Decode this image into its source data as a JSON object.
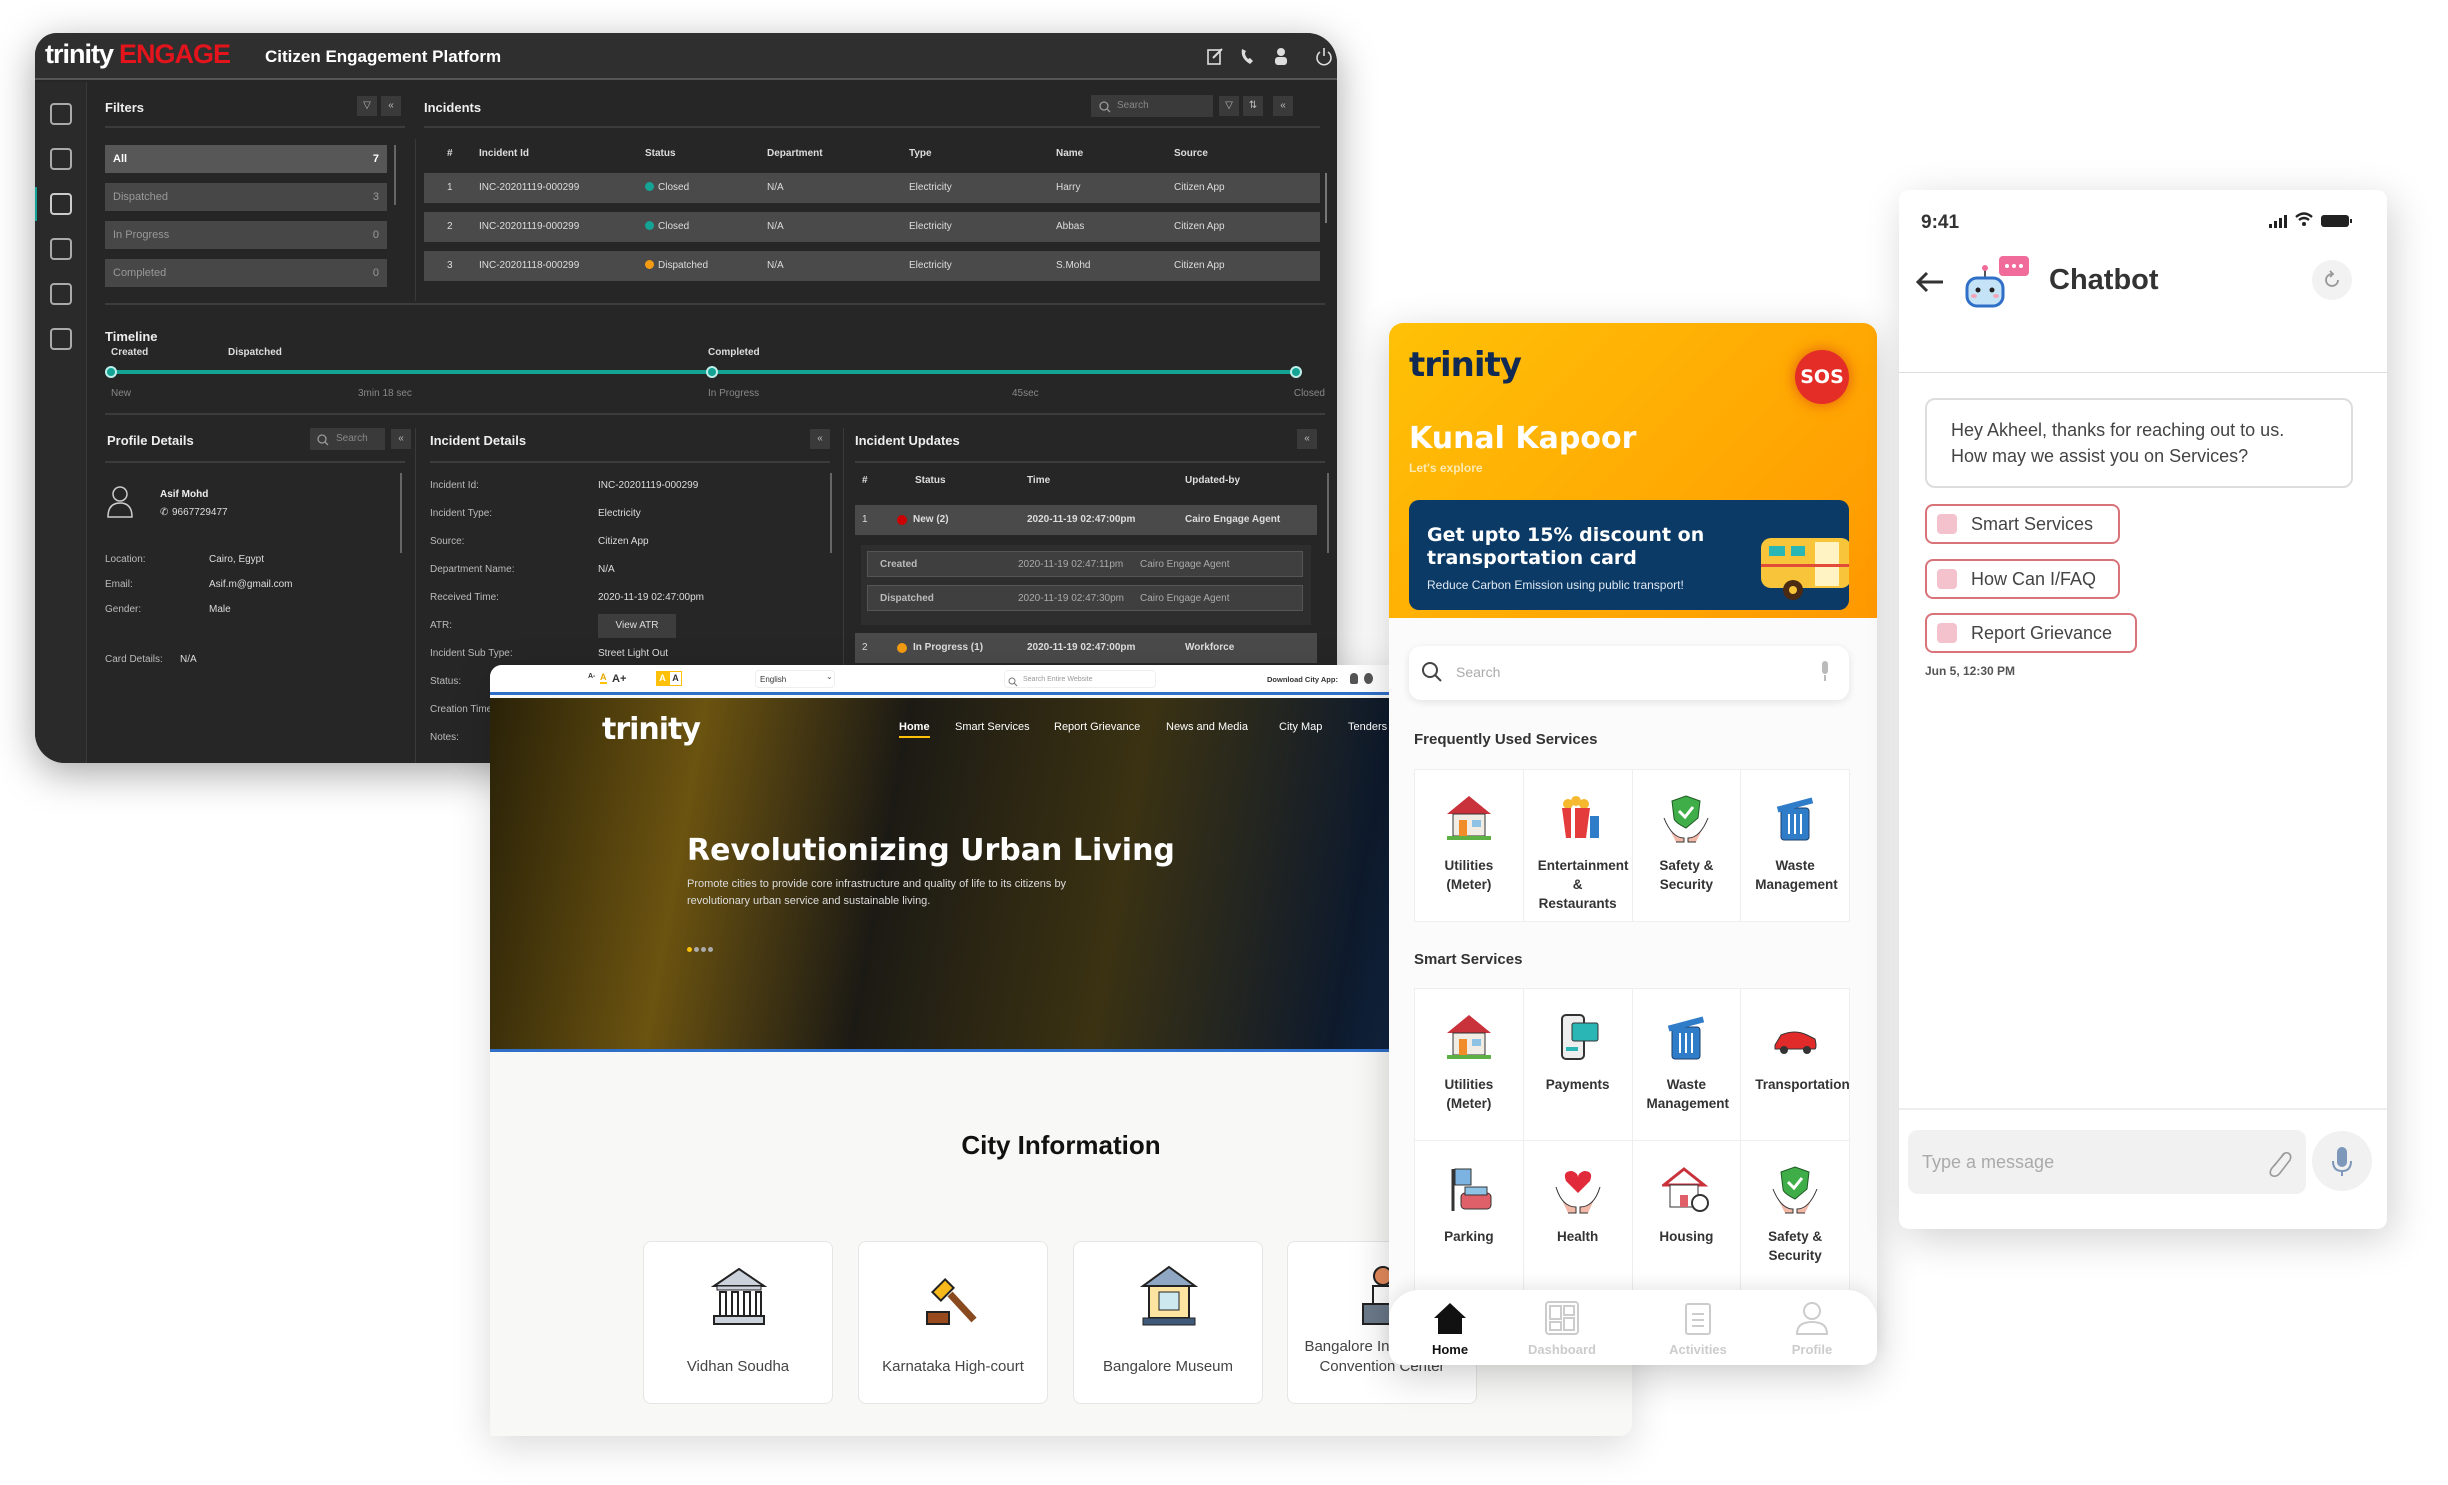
{
  "dashboard": {
    "brand_a": "trinity",
    "brand_b": "ENGAGE",
    "title": "Citizen Engagement Platform",
    "header_icons": [
      "edit-icon",
      "phone-icon",
      "user-icon",
      "power-icon"
    ],
    "sidebar_icons": [
      "dashboard-icon",
      "home-icon",
      "alarm-icon",
      "phone-icon",
      "clipboard-icon",
      "gear-icon"
    ],
    "filters": {
      "title": "Filters",
      "items": [
        {
          "label": "All",
          "count": "7"
        },
        {
          "label": "Dispatched",
          "count": "3"
        },
        {
          "label": "In Progress",
          "count": "0"
        },
        {
          "label": "Completed",
          "count": "0"
        }
      ]
    },
    "incidents": {
      "title": "Incidents",
      "search_placeholder": "Search",
      "columns": [
        "#",
        "Incident Id",
        "Status",
        "Department",
        "Type",
        "Name",
        "Source"
      ],
      "rows": [
        {
          "num": "1",
          "id": "INC-20201119-000299",
          "status": "Closed",
          "status_color": "#14a394",
          "dept": "N/A",
          "type": "Electricity",
          "name": "Harry",
          "source": "Citizen App"
        },
        {
          "num": "2",
          "id": "INC-20201119-000299",
          "status": "Closed",
          "status_color": "#14a394",
          "dept": "N/A",
          "type": "Electricity",
          "name": "Abbas",
          "source": "Citizen App"
        },
        {
          "num": "3",
          "id": "INC-20201118-000299",
          "status": "Dispatched",
          "status_color": "#f39c12",
          "dept": "N/A",
          "type": "Electricity",
          "name": "S.Mohd",
          "source": "Citizen App"
        }
      ]
    },
    "timeline": {
      "title": "Timeline",
      "top_labels": [
        "Created",
        "Dispatched",
        "Completed"
      ],
      "bottom_labels": [
        "New",
        "3min 18 sec",
        "In Progress",
        "45sec",
        "Closed"
      ],
      "color": "#14a394"
    },
    "profile": {
      "title": "Profile Details",
      "search_placeholder": "Search",
      "name": "Asif Mohd",
      "phone": "9667729477",
      "fields": [
        {
          "label": "Location:",
          "value": "Cairo, Egypt"
        },
        {
          "label": "Email:",
          "value": "Asif.m@gmail.com"
        },
        {
          "label": "Gender:",
          "value": "Male"
        },
        {
          "label": "Card Details:",
          "value": "N/A"
        }
      ]
    },
    "incident_details": {
      "title": "Incident Details",
      "atr_button": "View ATR",
      "fields": [
        {
          "label": "Incident Id:",
          "value": "INC-20201119-000299"
        },
        {
          "label": "Incident Type:",
          "value": "Electricity"
        },
        {
          "label": "Source:",
          "value": "Citizen App"
        },
        {
          "label": "Department Name:",
          "value": "N/A"
        },
        {
          "label": "Received Time:",
          "value": "2020-11-19 02:47:00pm"
        },
        {
          "label": "ATR:",
          "value": ""
        },
        {
          "label": "Incident Sub Type:",
          "value": "Street Light Out"
        },
        {
          "label": "Status:",
          "value": ""
        },
        {
          "label": "Creation Time:",
          "value": ""
        },
        {
          "label": "Notes:",
          "value": ""
        }
      ]
    },
    "updates": {
      "title": "Incident Updates",
      "columns": [
        "#",
        "Status",
        "Time",
        "Updated-by"
      ],
      "rows": [
        {
          "num": "1",
          "status": "New (2)",
          "status_color": "#cc0000",
          "time": "2020-11-19 02:47:00pm",
          "by": "Cairo Engage Agent"
        },
        {
          "num": "2",
          "status": "In Progress (1)",
          "status_color": "#f39c12",
          "time": "2020-11-19 02:47:00pm",
          "by": "Workforce"
        }
      ],
      "sub_rows": [
        {
          "status": "Created",
          "time": "2020-11-19 02:47:11pm",
          "by": "Cairo Engage Agent"
        },
        {
          "status": "Dispatched",
          "time": "2020-11-19 02:47:30pm",
          "by": "Cairo Engage Agent"
        }
      ]
    }
  },
  "website": {
    "font_controls": [
      "A-",
      "A",
      "A+"
    ],
    "contrast": [
      "A",
      "A"
    ],
    "language": "English",
    "search_placeholder": "Search Entire Website",
    "download_label": "Download City App:",
    "logo": "trinity",
    "nav": [
      "Home",
      "Smart Services",
      "Report Grievance",
      "News and Media",
      "City Map",
      "Tenders"
    ],
    "active_nav": "Home",
    "hero_title": "Revolutionizing Urban Living",
    "hero_text_1": "Promote cities to provide core infrastructure and quality of life to its citizens by",
    "hero_text_2": "revolutionary urban service and sustainable living.",
    "slides": 4,
    "active_slide": 1,
    "section_title": "City Information",
    "cards": [
      "Vidhan Soudha",
      "Karnataka High-court",
      "Bangalore Museum",
      "Bangalore International Convention Center"
    ],
    "accent": "#ffc107"
  },
  "mobile": {
    "logo": "trinity",
    "sos": "SOS",
    "user_name": "Kunal Kapoor",
    "subtitle": "Let's explore",
    "banner_title_1": "Get upto 15% discount on",
    "banner_title_2": "transportation card",
    "banner_text": "Reduce Carbon Emission using public transport!",
    "search_placeholder": "Search",
    "frequent_title": "Frequently Used Services",
    "frequent": [
      {
        "label": "Utilities (Meter)",
        "icon": "house"
      },
      {
        "label": "Entertainment & Restaurants",
        "icon": "popcorn"
      },
      {
        "label": "Safety & Security",
        "icon": "shield"
      },
      {
        "label": "Waste Management",
        "icon": "trash"
      }
    ],
    "smart_title": "Smart Services",
    "smart": [
      {
        "label": "Utilities (Meter)",
        "icon": "house"
      },
      {
        "label": "Payments",
        "icon": "card"
      },
      {
        "label": "Waste Management",
        "icon": "trash"
      },
      {
        "label": "Transportation",
        "icon": "car"
      },
      {
        "label": "Parking",
        "icon": "parking"
      },
      {
        "label": "Health",
        "icon": "heart"
      },
      {
        "label": "Housing",
        "icon": "housing"
      },
      {
        "label": "Safety & Security",
        "icon": "shield"
      }
    ],
    "bottom_nav": [
      "Home",
      "Dashboard",
      "Activities",
      "Profile"
    ],
    "active_tab": "Home"
  },
  "chatbot": {
    "time": "9:41",
    "title": "Chatbot",
    "message_1": "Hey Akheel, thanks for reaching out to us.",
    "message_2": "How may we assist you on Services?",
    "options": [
      "Smart Services",
      "How Can I/FAQ",
      "Report Grievance"
    ],
    "timestamp": "Jun 5, 12:30 PM",
    "input_placeholder": "Type a message",
    "accent": "#d9737a"
  }
}
